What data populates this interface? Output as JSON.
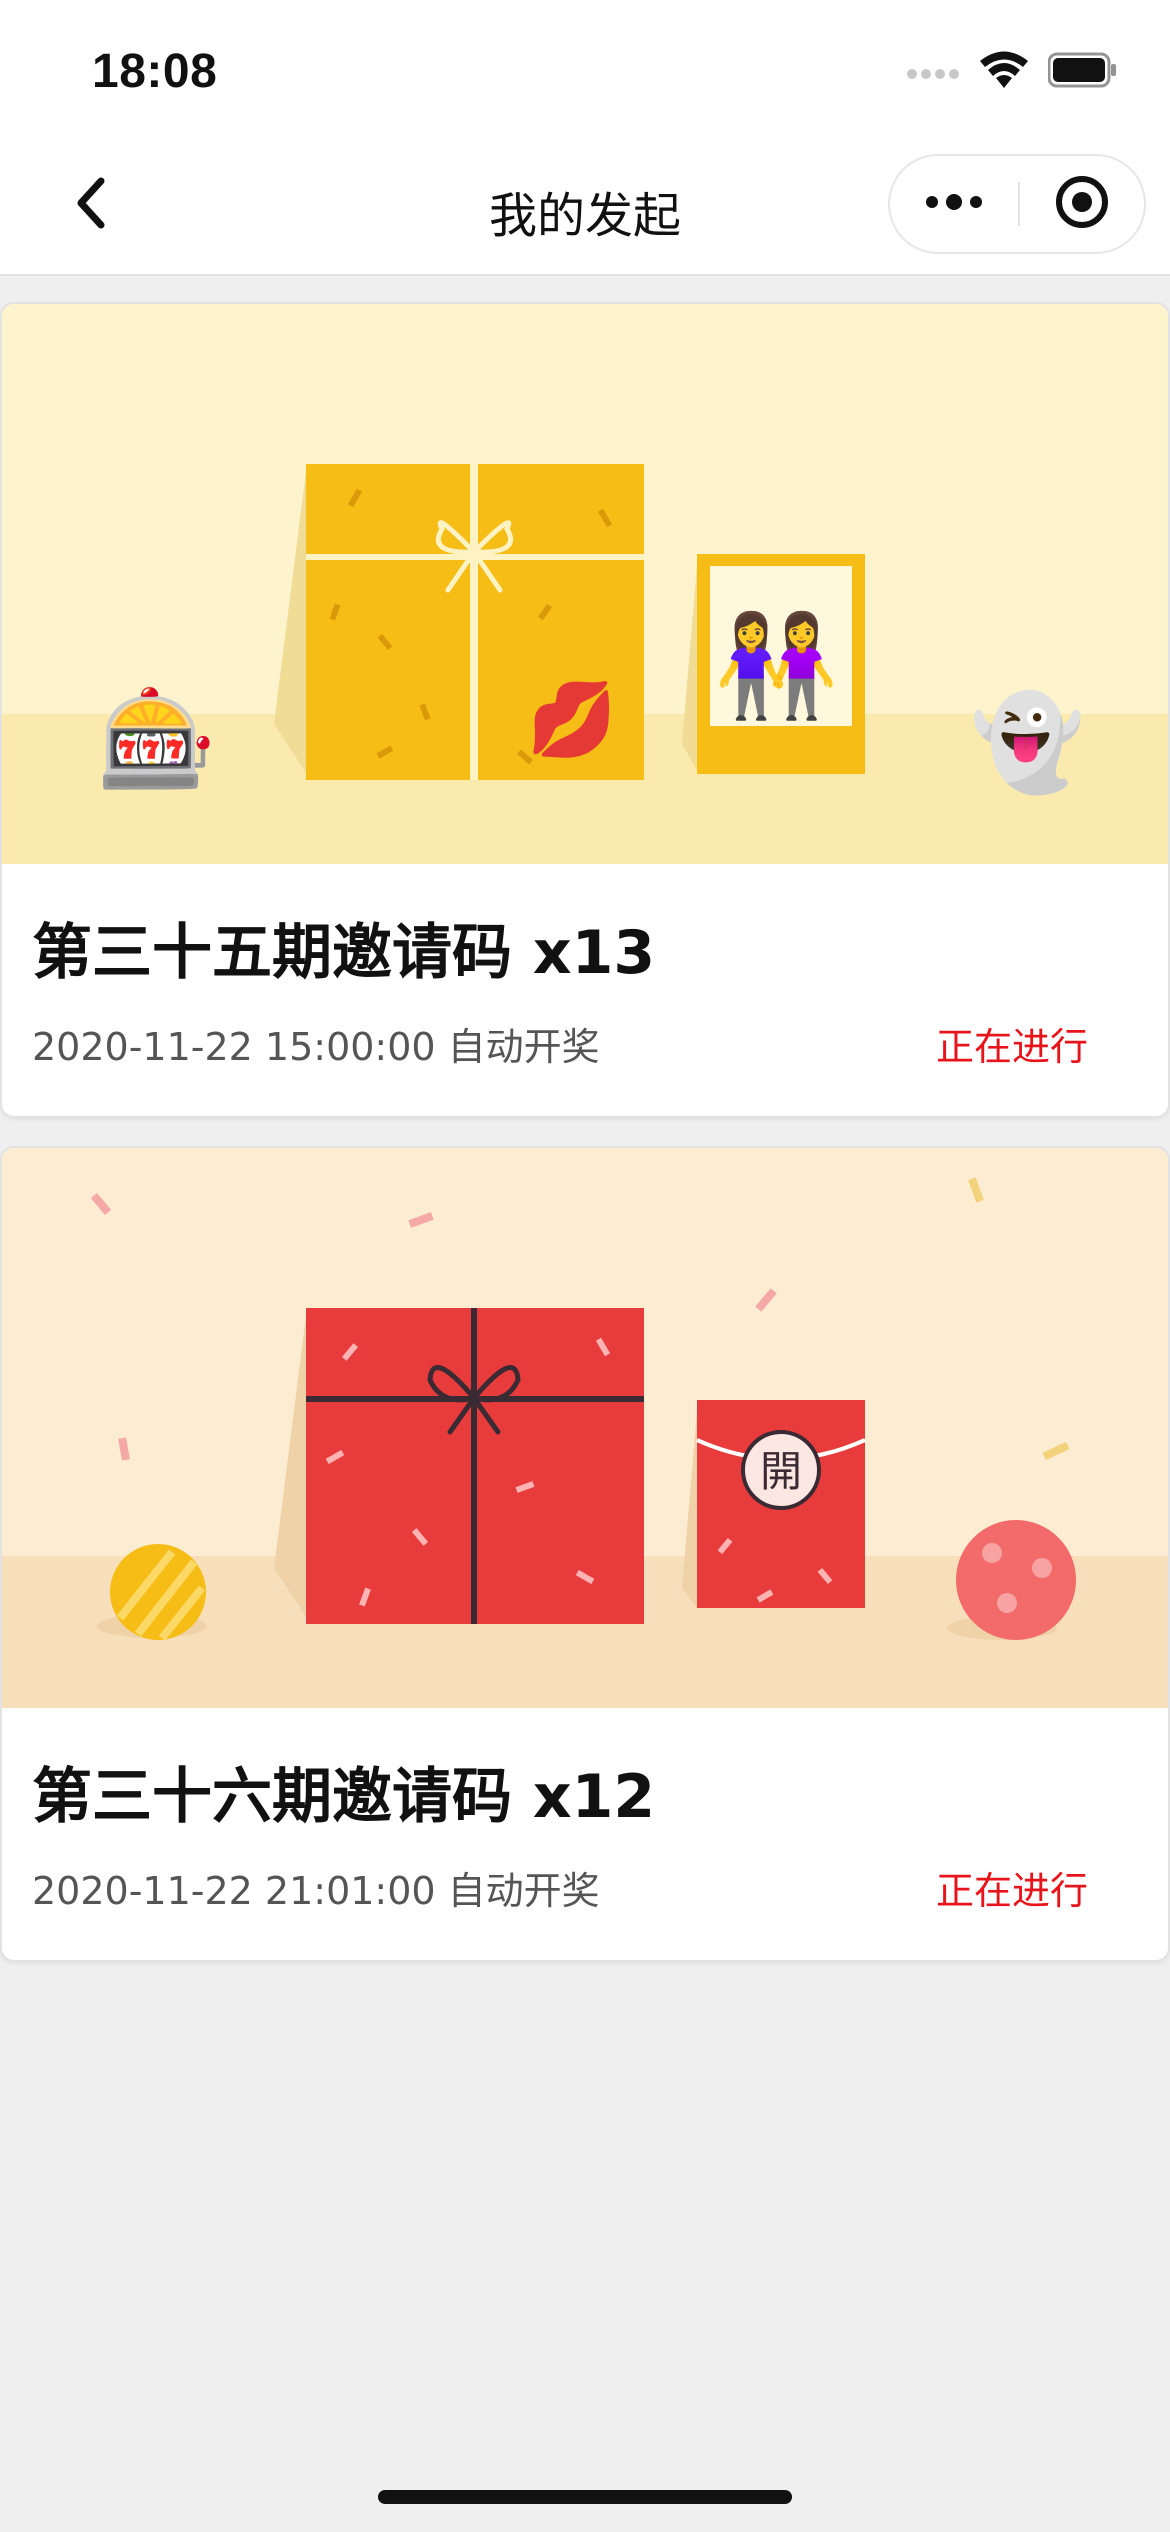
{
  "status_bar": {
    "time": "18:08",
    "icons": [
      "signal-icon",
      "wifi-icon",
      "battery-icon"
    ]
  },
  "nav": {
    "title": "我的发起",
    "back_icon": "chevron-left-icon",
    "more_icon": "more-dots-icon",
    "close_icon": "target-close-icon"
  },
  "cards": [
    {
      "title": "第三十五期邀请码 x13",
      "datetime": "2020-11-22 15:00:00 自动开奖",
      "status": "正在进行",
      "theme": {
        "background": "#fdf3cc",
        "box": "#f6bd16",
        "ribbon": "#fff3c4",
        "emojis": [
          "🎰",
          "💋",
          "👭",
          "👻"
        ]
      }
    },
    {
      "title": "第三十六期邀请码 x12",
      "datetime": "2020-11-22 21:01:00 自动开奖",
      "status": "正在进行",
      "theme": {
        "background": "#fcecd1",
        "box": "#e83b3b",
        "ribbon": "#3a2a33",
        "envelope_char": "開"
      }
    }
  ],
  "colors": {
    "status_active": "#e8141b",
    "page_bg": "#efefef"
  }
}
